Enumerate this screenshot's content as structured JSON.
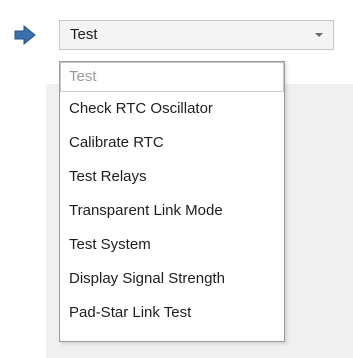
{
  "combo": {
    "value": "Test"
  },
  "dropdown": {
    "items": [
      {
        "label": "Test",
        "state": "disabled"
      },
      {
        "label": "Check RTC Oscillator"
      },
      {
        "label": "Calibrate RTC"
      },
      {
        "label": "Test Relays"
      },
      {
        "label": "Transparent Link Mode"
      },
      {
        "label": "Test System"
      },
      {
        "label": "Display Signal Strength"
      },
      {
        "label": "Pad-Star Link Test"
      }
    ]
  },
  "icons": {
    "indicator": "arrow-right-icon",
    "caret": "chevron-down-icon"
  },
  "colors": {
    "arrow": "#3a6fb0",
    "disabled_text": "#9a9a9a"
  }
}
